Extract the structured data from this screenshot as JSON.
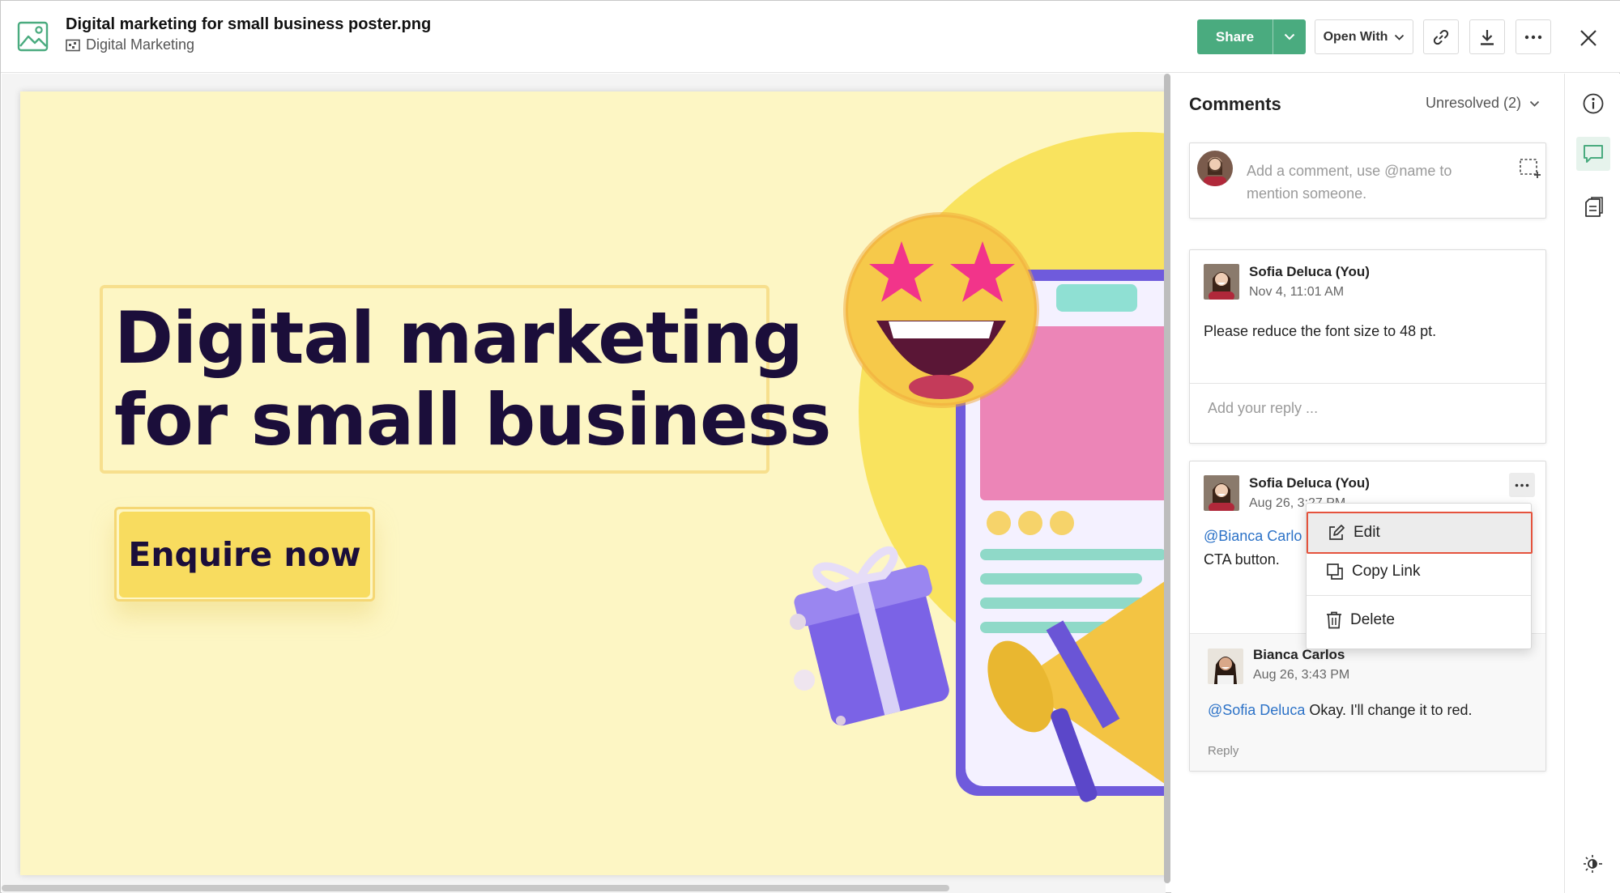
{
  "header": {
    "file_name": "Digital marketing for small business poster.png",
    "folder_name": "Digital Marketing",
    "share_label": "Share",
    "open_with_label": "Open With",
    "icons": [
      "image-file-icon",
      "folder-icon",
      "link-icon",
      "download-icon",
      "more-icon",
      "close-icon"
    ]
  },
  "poster": {
    "headline_line1": "Digital marketing",
    "headline_line2": "for small business",
    "cta_label": "Enquire now",
    "colors": {
      "background": "#fdf6c4",
      "text": "#1b0e3a",
      "cta": "#f8dc5f",
      "sun": "#f9e35e"
    }
  },
  "comments": {
    "title": "Comments",
    "filter_label": "Unresolved (2)",
    "new_comment_placeholder": "Add a comment, use @name to mention someone.",
    "threads": [
      {
        "author": "Sofia Deluca (You)",
        "time": "Nov 4, 11:01 AM",
        "text": "Please reduce the font size to 48 pt.",
        "reply_placeholder": "Add your reply ..."
      },
      {
        "author": "Sofia Deluca (You)",
        "time": "Aug 26, 3:27 PM",
        "mention": "@Bianca Carlo",
        "text_line2": "CTA button.",
        "reply": {
          "author": "Bianca Carlos",
          "time": "Aug 26, 3:43 PM",
          "mention": "@Sofia Deluca",
          "text": " Okay. I'll change it to red.",
          "reply_label": "Reply"
        }
      }
    ]
  },
  "context_menu": {
    "items": [
      {
        "label": "Edit",
        "icon": "edit-icon",
        "selected": true
      },
      {
        "label": "Copy Link",
        "icon": "copy-icon"
      },
      {
        "label": "Delete",
        "icon": "trash-icon"
      }
    ]
  },
  "rail": {
    "items": [
      "info-icon",
      "comments-icon",
      "activity-icon",
      "theme-toggle-icon"
    ],
    "active": "comments-icon"
  },
  "accent_color": "#4aab7f"
}
